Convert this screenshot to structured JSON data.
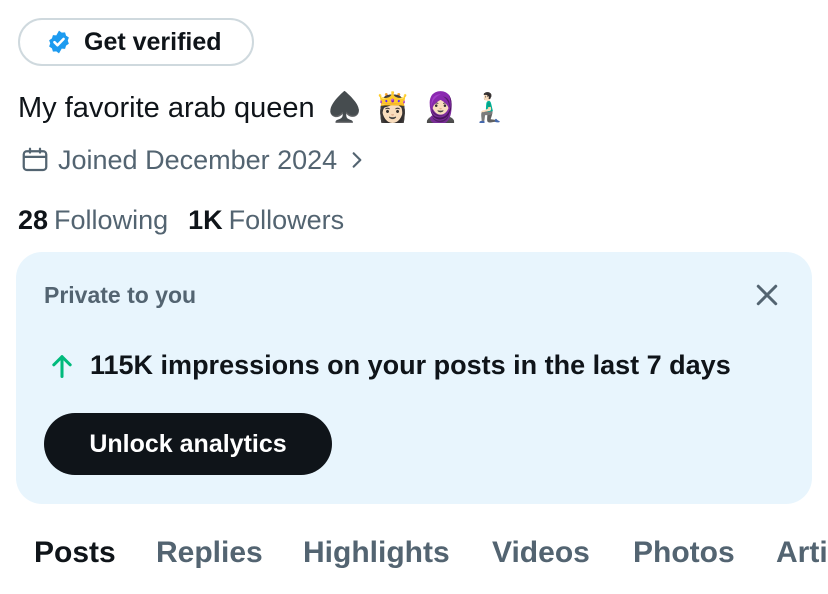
{
  "verify": {
    "label": "Get verified"
  },
  "bio": {
    "text": "My favorite arab queen",
    "emojis": [
      "♠️",
      "👸🏻",
      "🧕🏻",
      "🧎🏻‍♂️"
    ]
  },
  "joined": {
    "text": "Joined December 2024"
  },
  "stats": {
    "following": {
      "count": "28",
      "label": "Following"
    },
    "followers": {
      "count": "1K",
      "label": "Followers"
    }
  },
  "card": {
    "private_label": "Private to you",
    "impressions": "115K impressions on your posts in the last 7 days",
    "button": "Unlock analytics"
  },
  "tabs": [
    "Posts",
    "Replies",
    "Highlights",
    "Videos",
    "Photos",
    "Articles"
  ],
  "colors": {
    "verify_blue": "#1d9bf0",
    "up_green": "#00ba7c",
    "card_bg": "#e8f5fd"
  }
}
